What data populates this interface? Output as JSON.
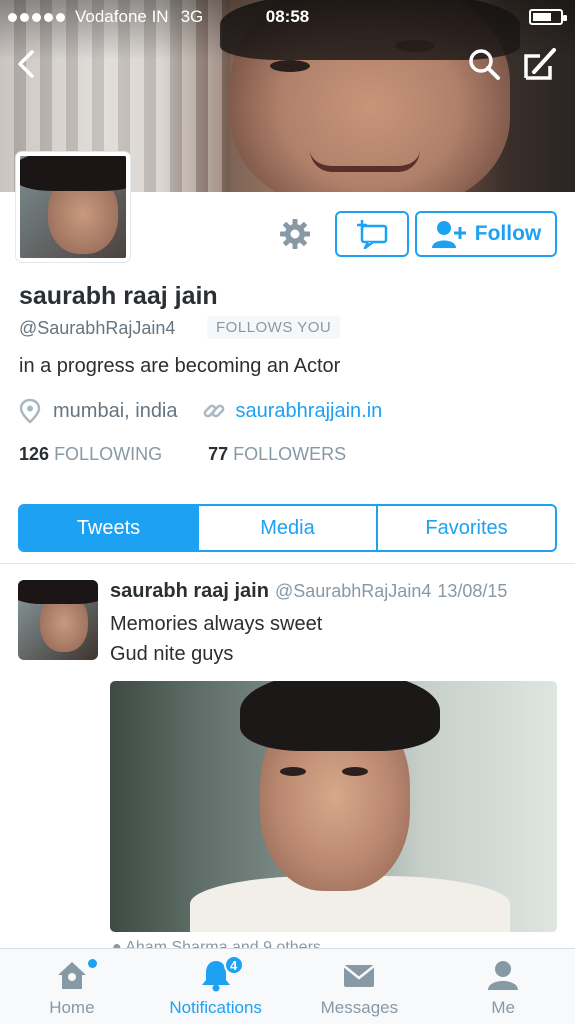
{
  "status_bar": {
    "carrier": "Vodafone IN",
    "network": "3G",
    "time": "08:58"
  },
  "profile": {
    "name": "saurabh raaj jain",
    "handle": "@SaurabhRajJain4",
    "follows_you": "FOLLOWS YOU",
    "bio": "in a progress are becoming an Actor",
    "location": "mumbai, india",
    "website": "saurabhrajjain.in",
    "following_count": "126",
    "following_label": "FOLLOWING",
    "followers_count": "77",
    "followers_label": "FOLLOWERS",
    "follow_button": "Follow"
  },
  "tabs": [
    {
      "label": "Tweets",
      "active": true
    },
    {
      "label": "Media",
      "active": false
    },
    {
      "label": "Favorites",
      "active": false
    }
  ],
  "tweet": {
    "name": "saurabh raaj jain",
    "handle": "@SaurabhRajJain4",
    "date": "13/08/15",
    "line1": "Memories always sweet",
    "line2": "Gud nite guys",
    "social_context": "Aham Sharma and 9 others"
  },
  "tabbar": {
    "items": [
      {
        "label": "Home",
        "icon": "home-icon"
      },
      {
        "label": "Notifications",
        "icon": "bell-icon",
        "badge": "4"
      },
      {
        "label": "Messages",
        "icon": "envelope-icon"
      },
      {
        "label": "Me",
        "icon": "person-icon"
      }
    ]
  },
  "colors": {
    "accent": "#1da1f2",
    "text": "#292f33",
    "secondary": "#8899a6"
  }
}
